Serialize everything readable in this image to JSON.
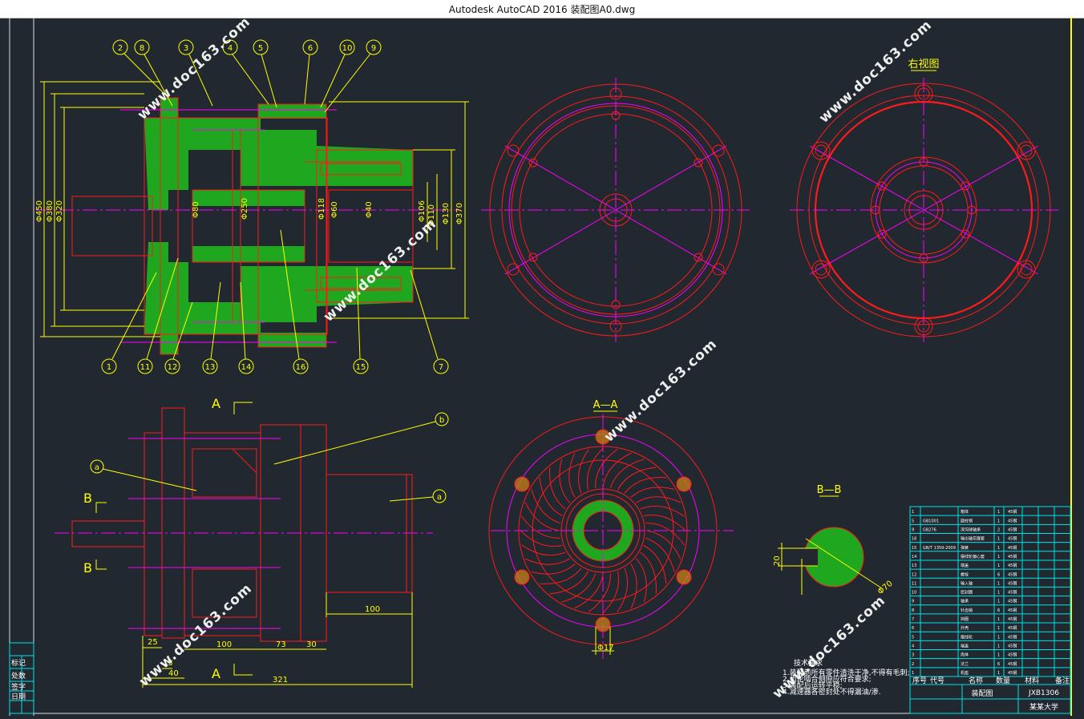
{
  "window": {
    "title": "Autodesk AutoCAD 2016     装配图A0.dwg"
  },
  "colors": {
    "background": "#212830",
    "dimension": "#ffff00",
    "outline": "#ff1a1a",
    "centerline": "#ff00ff",
    "section_fill": "#1fa81f",
    "table": "#00e5e5"
  },
  "balloons_top": [
    "2",
    "8",
    "3",
    "4",
    "5",
    "6",
    "10",
    "9"
  ],
  "balloons_bottom": [
    "1",
    "11",
    "12",
    "13",
    "14",
    "16",
    "15",
    "7"
  ],
  "main_view": {
    "dims_left": [
      "Φ450",
      "Φ380",
      "Φ320"
    ],
    "dims_inner": [
      "Φ80",
      "Φ250",
      "Φ118",
      "Φ60",
      "Φ40",
      "Φ106",
      "Φ110",
      "Φ130",
      "Φ370"
    ]
  },
  "right_view": {
    "title": "右视图"
  },
  "front_view": {
    "section_mark": "A",
    "section_mark_b": "B",
    "leaders": [
      "a",
      "b",
      "a"
    ],
    "dims": [
      "25",
      "13",
      "40",
      "100",
      "73",
      "30",
      "321",
      "100"
    ]
  },
  "section_aa": {
    "title": "A—A",
    "dim": "Φ17"
  },
  "section_bb": {
    "title": "B—B",
    "dims": [
      "20",
      "Φ70"
    ]
  },
  "notes": {
    "heading": "技术要求",
    "lines": [
      "1.装配前所有零件清洗干净,不得有毛刺;",
      "2.齿轮啮合侧隙应符合要求;",
      "3.装配后运转平稳;",
      "4.减速器各密封处不得漏油/渗."
    ]
  },
  "bom": {
    "rows": [
      {
        "no": "1",
        "code": "",
        "name": "箱体",
        "qty": "1",
        "mat": "45钢"
      },
      {
        "no": "5",
        "code": "GB1001",
        "name": "圆柱销",
        "qty": "1",
        "mat": "45钢"
      },
      {
        "no": "9",
        "code": "GB276",
        "name": "深沟球轴承",
        "qty": "2",
        "mat": "45钢"
      },
      {
        "no": "16",
        "code": "",
        "name": "输出轴花键套",
        "qty": "1",
        "mat": "45钢"
      },
      {
        "no": "15",
        "code": "GB/T 1359-2009",
        "name": "弹簧",
        "qty": "1",
        "mat": "45钢"
      },
      {
        "no": "14",
        "code": "",
        "name": "摆线轮偏心套",
        "qty": "1",
        "mat": "45钢"
      },
      {
        "no": "13",
        "code": "",
        "name": "端盖",
        "qty": "1",
        "mat": "45钢"
      },
      {
        "no": "12",
        "code": "",
        "name": "螺栓",
        "qty": "6",
        "mat": "45钢"
      },
      {
        "no": "11",
        "code": "",
        "name": "输入轴",
        "qty": "1",
        "mat": "45钢"
      },
      {
        "no": "10",
        "code": "",
        "name": "密封圈",
        "qty": "1",
        "mat": "45钢"
      },
      {
        "no": "9",
        "code": "",
        "name": "轴承",
        "qty": "1",
        "mat": "45钢"
      },
      {
        "no": "8",
        "code": "",
        "name": "针齿销",
        "qty": "6",
        "mat": "45钢"
      },
      {
        "no": "7",
        "code": "",
        "name": "挡圈",
        "qty": "1",
        "mat": "45钢"
      },
      {
        "no": "6",
        "code": "",
        "name": "外壳",
        "qty": "1",
        "mat": "45钢"
      },
      {
        "no": "5",
        "code": "",
        "name": "摆线轮",
        "qty": "1",
        "mat": "45钢"
      },
      {
        "no": "4",
        "code": "",
        "name": "端盖",
        "qty": "1",
        "mat": "45钢"
      },
      {
        "no": "3",
        "code": "",
        "name": "壳体",
        "qty": "1",
        "mat": "45钢"
      },
      {
        "no": "2",
        "code": "",
        "name": "法兰",
        "qty": "6",
        "mat": "45钢"
      },
      {
        "no": "1",
        "code": "",
        "name": "机座",
        "qty": "1",
        "mat": "45钢"
      }
    ],
    "header": [
      "序号",
      "代号",
      "名称",
      "数量",
      "材料",
      "备注"
    ],
    "drawing_name": "装配图",
    "company": "某某大学",
    "sheet_no": "JXB1306"
  },
  "left_strip": {
    "labels": [
      "标记",
      "处数",
      "签字",
      "日期"
    ]
  },
  "watermark": "www.doc163.com"
}
